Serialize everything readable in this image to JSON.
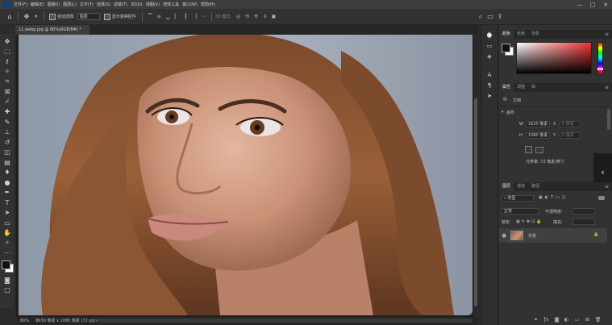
{
  "app": {
    "logo": "Ps"
  },
  "menubar": {
    "items": [
      "文件(F)",
      "编辑(E)",
      "图像(I)",
      "图层(L)",
      "文字(Y)",
      "选择(S)",
      "滤镜(T)",
      "3D(D)",
      "视图(V)",
      "增效工具",
      "窗口(W)",
      "帮助(H)"
    ],
    "win_controls": [
      "—",
      "▢",
      "✕"
    ]
  },
  "options": {
    "auto_select_label": "自动选择:",
    "auto_select_value": "图层",
    "show_transform_label": "显示变换控件",
    "mode_3d_label": "3D 模式:"
  },
  "document": {
    "tab_title": "11.webp.jpg @ 80%(RGB/8#) *",
    "zoom": "80%",
    "doc_info": "8630 像素 x 1080 像素 (72 ppi)"
  },
  "color_panel": {
    "tabs": [
      "颜色",
      "色板",
      "渐变"
    ],
    "fg_color": "#111111",
    "bg_color": "#ffffff",
    "accent": "#e03030"
  },
  "properties_panel": {
    "tabs": [
      "属性",
      "调整",
      "库"
    ],
    "doc_label": "文档",
    "canvas_label": "画布",
    "w_label": "W",
    "w_value": "1620 像素",
    "x_label": "X",
    "x_placeholder": "0 像素",
    "h_label": "H",
    "h_value": "1080 像素",
    "y_label": "Y",
    "y_placeholder": "0 像素",
    "resolution": "分辨率: 72 像素/英寸"
  },
  "layers_panel": {
    "tabs": [
      "图层",
      "通道",
      "路径"
    ],
    "filter_label": "类型",
    "blend_mode": "正常",
    "opacity_label": "不透明度:",
    "lock_label": "锁定:",
    "fill_label": "填充:",
    "layers": [
      {
        "name": "背景"
      }
    ]
  }
}
